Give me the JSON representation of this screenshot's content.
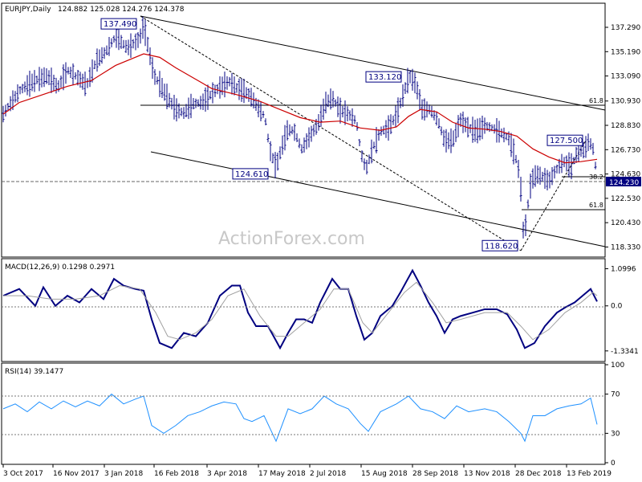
{
  "header": {
    "symbol": "EURJPY,Daily",
    "ohlc": "124.882 125.028 124.276 124.378"
  },
  "watermark": "ActionForex.com",
  "colors": {
    "price": "#000080",
    "sma": "#cc0000",
    "macd": "#000080",
    "signal": "#a0a0a0",
    "rsi": "#1e90ff",
    "frame": "#000000",
    "trendline": "#000000",
    "current_price_box": "#000080"
  },
  "chart_data": [
    {
      "type": "candlestick",
      "panel": "price",
      "title": "EURJPY,Daily",
      "x_tick_labels": [
        "3 Oct 2017",
        "16 Nov 2017",
        "3 Jan 2018",
        "16 Feb 2018",
        "3 Apr 2018",
        "17 May 2018",
        "2 Jul 2018",
        "15 Aug 2018",
        "28 Sep 2018",
        "13 Nov 2018",
        "28 Dec 2018",
        "13 Feb 2019"
      ],
      "y_tick_labels": [
        "137.290",
        "135.190",
        "133.090",
        "130.930",
        "128.830",
        "126.730",
        "124.630",
        "122.530",
        "120.430",
        "118.330"
      ],
      "ylim": [
        117.6,
        138.4
      ],
      "current_price": 124.23,
      "current_price_label": "124.230",
      "series_outline": [
        [
          0,
          129.8
        ],
        [
          10,
          130.8
        ],
        [
          20,
          131.8
        ],
        [
          30,
          132.3
        ],
        [
          40,
          132.7
        ],
        [
          55,
          133.1
        ],
        [
          68,
          132.1
        ],
        [
          80,
          133.6
        ],
        [
          92,
          133.0
        ],
        [
          104,
          132.3
        ],
        [
          116,
          134.4
        ],
        [
          128,
          135.2
        ],
        [
          140,
          136.5
        ],
        [
          155,
          135.5
        ],
        [
          170,
          136.3
        ],
        [
          175,
          137.49
        ],
        [
          180,
          135.8
        ],
        [
          188,
          133.1
        ],
        [
          196,
          132.3
        ],
        [
          205,
          131.2
        ],
        [
          215,
          130.2
        ],
        [
          225,
          129.9
        ],
        [
          237,
          130.7
        ],
        [
          248,
          130.8
        ],
        [
          262,
          131.7
        ],
        [
          272,
          132.2
        ],
        [
          282,
          132.6
        ],
        [
          292,
          132.0
        ],
        [
          300,
          131.8
        ],
        [
          310,
          131.2
        ],
        [
          318,
          130.3
        ],
        [
          326,
          129.6
        ],
        [
          332,
          126.8
        ],
        [
          340,
          125.2
        ],
        [
          346,
          126.7
        ],
        [
          354,
          128.4
        ],
        [
          362,
          128.4
        ],
        [
          372,
          126.8
        ],
        [
          382,
          127.9
        ],
        [
          392,
          128.9
        ],
        [
          402,
          130.8
        ],
        [
          410,
          131.2
        ],
        [
          420,
          130.1
        ],
        [
          430,
          129.8
        ],
        [
          440,
          129.2
        ],
        [
          446,
          126.4
        ],
        [
          452,
          125.0
        ],
        [
          460,
          126.8
        ],
        [
          470,
          128.3
        ],
        [
          480,
          128.6
        ],
        [
          490,
          129.7
        ],
        [
          498,
          131.4
        ],
        [
          506,
          133.12
        ],
        [
          514,
          132.4
        ],
        [
          522,
          130.2
        ],
        [
          532,
          130.2
        ],
        [
          542,
          129.2
        ],
        [
          550,
          127.5
        ],
        [
          560,
          127.5
        ],
        [
          570,
          129.3
        ],
        [
          580,
          128.6
        ],
        [
          590,
          128.3
        ],
        [
          600,
          128.8
        ],
        [
          610,
          128.6
        ],
        [
          620,
          128.2
        ],
        [
          630,
          127.7
        ],
        [
          638,
          126.2
        ],
        [
          644,
          124.5
        ],
        [
          649,
          118.62
        ],
        [
          652,
          121.0
        ],
        [
          658,
          124.1
        ],
        [
          665,
          124.6
        ],
        [
          672,
          124.4
        ],
        [
          680,
          124.0
        ],
        [
          688,
          124.9
        ],
        [
          698,
          125.7
        ],
        [
          708,
          125.3
        ],
        [
          716,
          126.6
        ],
        [
          724,
          126.7
        ],
        [
          730,
          127.5
        ],
        [
          735,
          126.8
        ],
        [
          740,
          124.4
        ]
      ],
      "sma": [
        [
          0,
          129.8
        ],
        [
          20,
          130.8
        ],
        [
          50,
          131.5
        ],
        [
          80,
          132.2
        ],
        [
          110,
          132.7
        ],
        [
          140,
          134.0
        ],
        [
          175,
          135.0
        ],
        [
          195,
          134.7
        ],
        [
          215,
          133.8
        ],
        [
          240,
          132.8
        ],
        [
          260,
          132.0
        ],
        [
          290,
          131.5
        ],
        [
          320,
          130.9
        ],
        [
          345,
          130.2
        ],
        [
          370,
          129.5
        ],
        [
          395,
          129.1
        ],
        [
          420,
          129.2
        ],
        [
          445,
          128.6
        ],
        [
          470,
          128.4
        ],
        [
          490,
          128.7
        ],
        [
          505,
          129.6
        ],
        [
          520,
          130.2
        ],
        [
          540,
          130.0
        ],
        [
          560,
          129.1
        ],
        [
          580,
          128.6
        ],
        [
          600,
          128.5
        ],
        [
          620,
          128.3
        ],
        [
          640,
          127.9
        ],
        [
          660,
          126.8
        ],
        [
          680,
          126.1
        ],
        [
          700,
          125.6
        ],
        [
          720,
          125.7
        ],
        [
          740,
          125.9
        ]
      ],
      "annotations": [
        {
          "label": "137.490",
          "x": 175,
          "y": 137.49
        },
        {
          "label": "133.120",
          "x": 506,
          "y": 133.12
        },
        {
          "label": "124.610",
          "x": 340,
          "y": 124.61
        },
        {
          "label": "118.620",
          "x": 649,
          "y": 118.62
        },
        {
          "label": "127.500",
          "x": 730,
          "y": 127.5
        }
      ],
      "fib_labels": [
        "61.8",
        "38.2",
        "61.8"
      ]
    },
    {
      "type": "line",
      "panel": "macd",
      "title": "MACD(12,26,9) 0.1298 0.2971",
      "y_tick_labels": [
        "1.0996",
        "0.0",
        "-1.3341"
      ],
      "ylim": [
        -1.6,
        1.35
      ],
      "series": [
        {
          "name": "MACD",
          "values": [
            [
              0,
              0.3
            ],
            [
              20,
              0.5
            ],
            [
              40,
              0.0
            ],
            [
              50,
              0.55
            ],
            [
              65,
              0.0
            ],
            [
              80,
              0.3
            ],
            [
              95,
              0.1
            ],
            [
              110,
              0.5
            ],
            [
              125,
              0.2
            ],
            [
              138,
              0.8
            ],
            [
              150,
              0.6
            ],
            [
              165,
              0.5
            ],
            [
              175,
              0.45
            ],
            [
              185,
              -0.4
            ],
            [
              195,
              -1.1
            ],
            [
              210,
              -1.25
            ],
            [
              225,
              -0.8
            ],
            [
              240,
              -0.9
            ],
            [
              255,
              -0.5
            ],
            [
              270,
              0.3
            ],
            [
              285,
              0.6
            ],
            [
              295,
              0.6
            ],
            [
              305,
              -0.2
            ],
            [
              315,
              -0.6
            ],
            [
              330,
              -0.6
            ],
            [
              345,
              -1.25
            ],
            [
              355,
              -0.8
            ],
            [
              365,
              -0.4
            ],
            [
              375,
              -0.4
            ],
            [
              385,
              -0.5
            ],
            [
              395,
              0.1
            ],
            [
              410,
              0.8
            ],
            [
              420,
              0.5
            ],
            [
              430,
              0.5
            ],
            [
              440,
              -0.3
            ],
            [
              450,
              -1.0
            ],
            [
              460,
              -0.8
            ],
            [
              470,
              -0.3
            ],
            [
              485,
              0.0
            ],
            [
              495,
              0.4
            ],
            [
              510,
              1.05
            ],
            [
              520,
              0.6
            ],
            [
              530,
              0.1
            ],
            [
              540,
              -0.3
            ],
            [
              550,
              -0.8
            ],
            [
              560,
              -0.4
            ],
            [
              570,
              -0.3
            ],
            [
              585,
              -0.2
            ],
            [
              600,
              -0.1
            ],
            [
              615,
              -0.1
            ],
            [
              628,
              -0.25
            ],
            [
              640,
              -0.7
            ],
            [
              650,
              -1.25
            ],
            [
              662,
              -1.1
            ],
            [
              675,
              -0.6
            ],
            [
              690,
              -0.2
            ],
            [
              700,
              -0.05
            ],
            [
              712,
              0.1
            ],
            [
              722,
              0.3
            ],
            [
              732,
              0.5
            ],
            [
              740,
              0.13
            ]
          ]
        },
        {
          "name": "Signal",
          "values": [
            [
              0,
              0.3
            ],
            [
              30,
              0.3
            ],
            [
              60,
              0.2
            ],
            [
              90,
              0.2
            ],
            [
              120,
              0.3
            ],
            [
              145,
              0.6
            ],
            [
              170,
              0.5
            ],
            [
              190,
              -0.2
            ],
            [
              205,
              -0.9
            ],
            [
              220,
              -1.0
            ],
            [
              240,
              -0.8
            ],
            [
              260,
              -0.4
            ],
            [
              280,
              0.3
            ],
            [
              300,
              0.5
            ],
            [
              320,
              -0.3
            ],
            [
              340,
              -0.9
            ],
            [
              355,
              -0.9
            ],
            [
              375,
              -0.5
            ],
            [
              395,
              -0.1
            ],
            [
              412,
              0.5
            ],
            [
              430,
              0.5
            ],
            [
              448,
              -0.5
            ],
            [
              460,
              -0.8
            ],
            [
              480,
              -0.2
            ],
            [
              500,
              0.4
            ],
            [
              515,
              0.7
            ],
            [
              535,
              0.1
            ],
            [
              552,
              -0.5
            ],
            [
              570,
              -0.4
            ],
            [
              600,
              -0.2
            ],
            [
              628,
              -0.2
            ],
            [
              645,
              -0.6
            ],
            [
              660,
              -1.0
            ],
            [
              680,
              -0.7
            ],
            [
              700,
              -0.2
            ],
            [
              720,
              0.1
            ],
            [
              735,
              0.4
            ],
            [
              740,
              0.3
            ]
          ]
        }
      ]
    },
    {
      "type": "line",
      "panel": "rsi",
      "title": "RSI(14) 39.1477",
      "y_tick_labels": [
        "100",
        "70",
        "30",
        "0"
      ],
      "ylim": [
        0,
        100
      ],
      "series": [
        {
          "name": "RSI",
          "values": [
            [
              0,
              55
            ],
            [
              15,
              60
            ],
            [
              30,
              52
            ],
            [
              45,
              62
            ],
            [
              60,
              55
            ],
            [
              75,
              63
            ],
            [
              90,
              57
            ],
            [
              105,
              63
            ],
            [
              120,
              58
            ],
            [
              135,
              70
            ],
            [
              150,
              60
            ],
            [
              165,
              65
            ],
            [
              175,
              68
            ],
            [
              185,
              38
            ],
            [
              200,
              30
            ],
            [
              215,
              38
            ],
            [
              230,
              48
            ],
            [
              245,
              52
            ],
            [
              260,
              58
            ],
            [
              275,
              62
            ],
            [
              290,
              60
            ],
            [
              300,
              45
            ],
            [
              310,
              42
            ],
            [
              325,
              48
            ],
            [
              340,
              22
            ],
            [
              355,
              55
            ],
            [
              370,
              50
            ],
            [
              385,
              55
            ],
            [
              400,
              68
            ],
            [
              415,
              60
            ],
            [
              430,
              55
            ],
            [
              445,
              40
            ],
            [
              455,
              32
            ],
            [
              470,
              52
            ],
            [
              490,
              60
            ],
            [
              505,
              68
            ],
            [
              520,
              55
            ],
            [
              535,
              52
            ],
            [
              550,
              45
            ],
            [
              565,
              58
            ],
            [
              580,
              52
            ],
            [
              600,
              55
            ],
            [
              615,
              52
            ],
            [
              630,
              42
            ],
            [
              645,
              30
            ],
            [
              650,
              22
            ],
            [
              660,
              48
            ],
            [
              675,
              48
            ],
            [
              690,
              55
            ],
            [
              705,
              58
            ],
            [
              720,
              60
            ],
            [
              732,
              66
            ],
            [
              740,
              39
            ]
          ]
        }
      ]
    }
  ]
}
